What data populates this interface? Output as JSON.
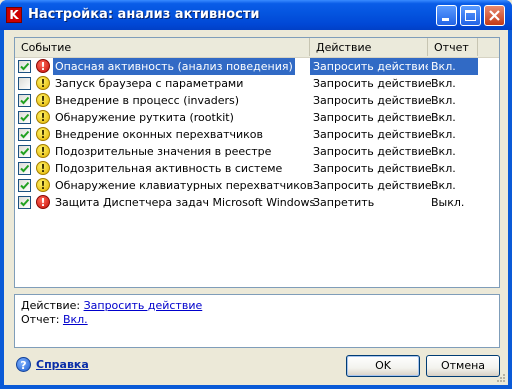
{
  "window": {
    "title": "Настройка: анализ активности",
    "app_icon": "kaspersky-k-icon",
    "app_icon_glyph": "K"
  },
  "list": {
    "columns": {
      "event": "Событие",
      "action": "Действие",
      "report": "Отчет"
    },
    "rows": [
      {
        "checked": true,
        "severity": "high",
        "event": "Опасная активность (анализ поведения)",
        "action": "Запросить действие",
        "report": "Вкл.",
        "selected": true
      },
      {
        "checked": false,
        "severity": "medium",
        "event": "Запуск браузера с параметрами",
        "action": "Запросить действие",
        "report": "Вкл.",
        "selected": false
      },
      {
        "checked": true,
        "severity": "medium",
        "event": "Внедрение в процесс (invaders)",
        "action": "Запросить действие",
        "report": "Вкл.",
        "selected": false
      },
      {
        "checked": true,
        "severity": "medium",
        "event": "Обнаружение руткита (rootkit)",
        "action": "Запросить действие",
        "report": "Вкл.",
        "selected": false
      },
      {
        "checked": true,
        "severity": "medium",
        "event": "Внедрение оконных перехватчиков",
        "action": "Запросить действие",
        "report": "Вкл.",
        "selected": false
      },
      {
        "checked": true,
        "severity": "medium",
        "event": "Подозрительные значения в реестре",
        "action": "Запросить действие",
        "report": "Вкл.",
        "selected": false
      },
      {
        "checked": true,
        "severity": "medium",
        "event": "Подозрительная активность в системе",
        "action": "Запросить действие",
        "report": "Вкл.",
        "selected": false
      },
      {
        "checked": true,
        "severity": "medium",
        "event": "Обнаружение клавиатурных перехватчиков",
        "action": "Запросить действие",
        "report": "Вкл.",
        "selected": false
      },
      {
        "checked": true,
        "severity": "high",
        "event": "Защита Диспетчера задач Microsoft Windows",
        "action": "Запретить",
        "report": "Выкл.",
        "selected": false
      }
    ]
  },
  "details": {
    "action_label": "Действие:",
    "action_value": "Запросить действие",
    "report_label": "Отчет:",
    "report_value": "Вкл."
  },
  "footer": {
    "help_label": "Справка",
    "help_icon": "help-question-icon",
    "ok_label": "OK",
    "cancel_label": "Отмена"
  },
  "colors": {
    "titlebar": "#0454df",
    "selection": "#316ac5",
    "link": "#0000cc",
    "severity_high": "#c8100a",
    "severity_medium": "#e3b400"
  }
}
